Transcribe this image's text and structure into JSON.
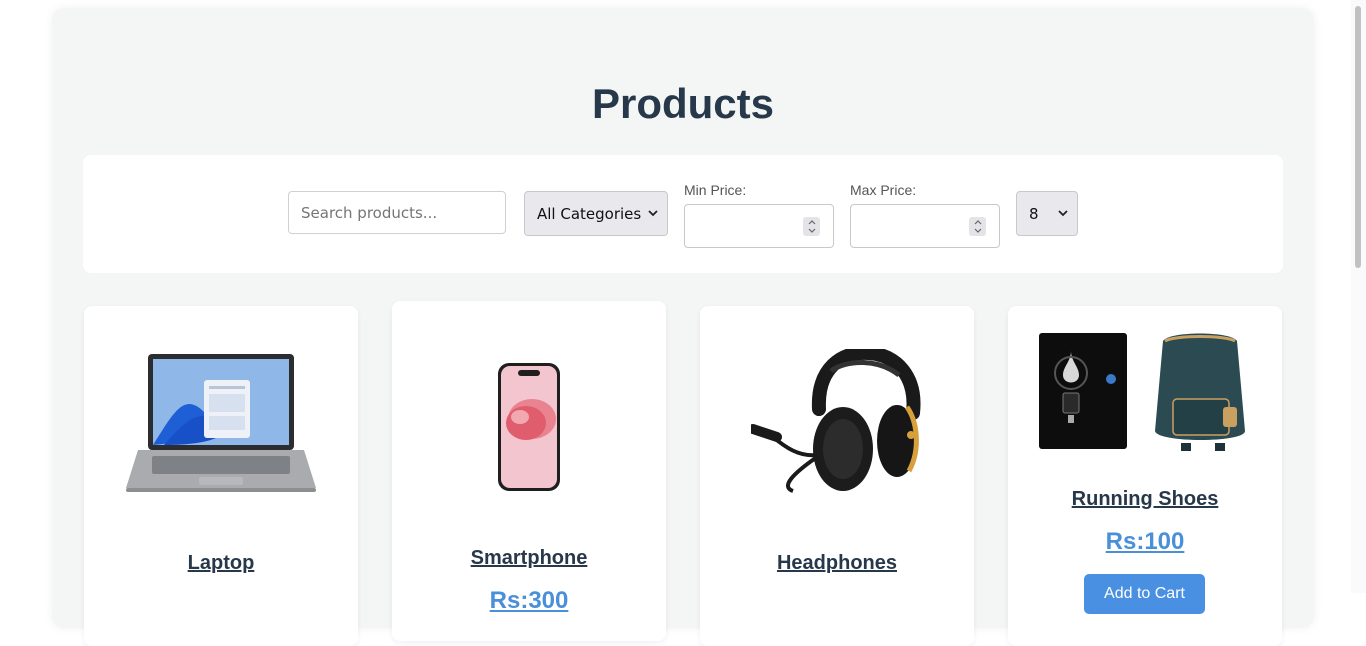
{
  "page": {
    "title": "Products"
  },
  "filters": {
    "search_placeholder": "Search products...",
    "category_selected": "All Categories",
    "min_price_label": "Min Price:",
    "max_price_label": "Max Price:",
    "per_page_selected": "8"
  },
  "products": [
    {
      "name": "Laptop"
    },
    {
      "name": "Smartphone",
      "price": "Rs:300"
    },
    {
      "name": "Headphones"
    },
    {
      "name": "Running Shoes",
      "price": "Rs:100",
      "button": "Add to Cart"
    }
  ],
  "icons": [
    "chevron-down-icon",
    "spinner-up-icon",
    "spinner-down-icon"
  ],
  "colors": {
    "title": "#27384a",
    "price": "#4a90d9",
    "button": "#4a90e2",
    "background": "#f4f5f5"
  }
}
